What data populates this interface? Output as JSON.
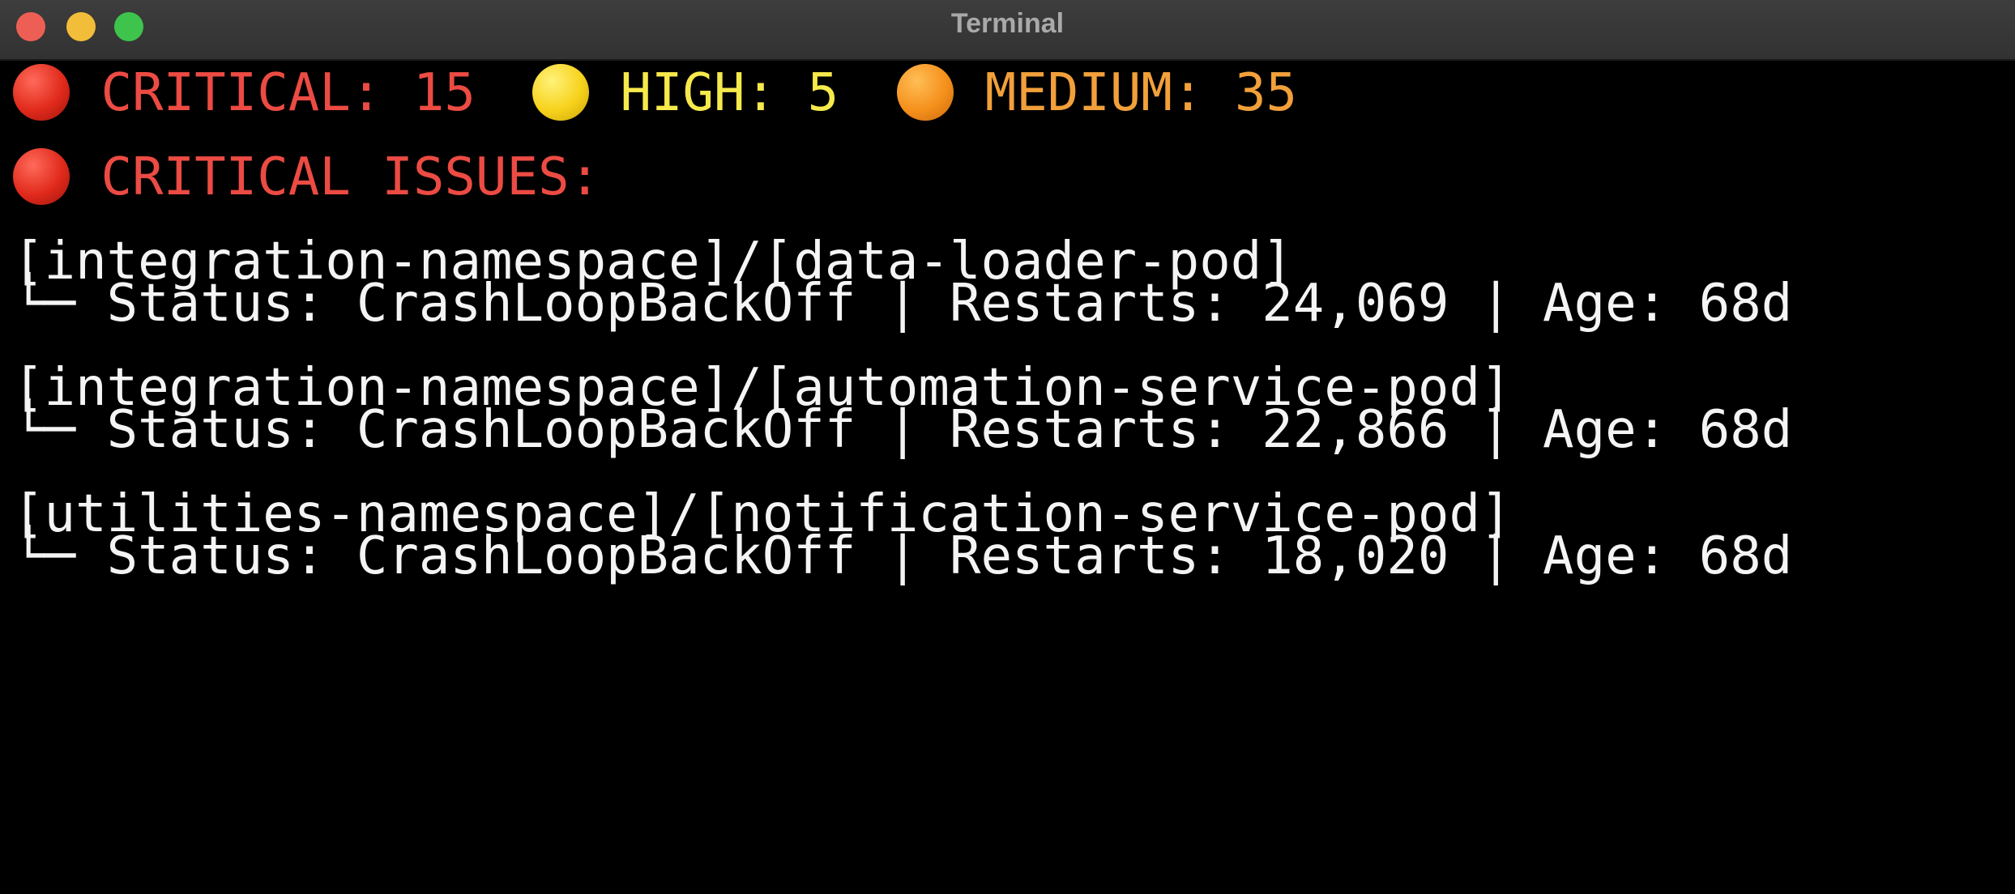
{
  "window": {
    "title": "Terminal"
  },
  "summary": {
    "critical": {
      "label": "CRITICAL:",
      "count": "15",
      "color": "#ec4b43",
      "icon": "red-circle-icon"
    },
    "high": {
      "label": "HIGH:",
      "count": "5",
      "color": "#f6e94c",
      "icon": "yellow-circle-icon"
    },
    "medium": {
      "label": "MEDIUM:",
      "count": "35",
      "color": "#f2a03a",
      "icon": "orange-circle-icon"
    }
  },
  "section": {
    "heading": "CRITICAL ISSUES:",
    "icon": "red-circle-icon"
  },
  "issues": [
    {
      "path": "[integration-namespace]/[data-loader-pod]",
      "detail": "└─ Status: CrashLoopBackOff | Restarts: 24,069 | Age: 68d"
    },
    {
      "path": "[integration-namespace]/[automation-service-pod]",
      "detail": "└─ Status: CrashLoopBackOff | Restarts: 22,866 | Age: 68d"
    },
    {
      "path": "[utilities-namespace]/[notification-service-pod]",
      "detail": "└─ Status: CrashLoopBackOff | Restarts: 18,020 | Age: 68d"
    }
  ]
}
